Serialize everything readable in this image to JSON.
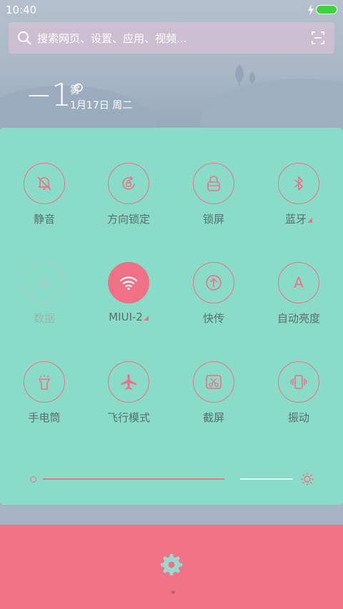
{
  "status_bar": {
    "time": "10:40"
  },
  "search": {
    "placeholder": "搜索网页、设置、应用、视频..."
  },
  "weather": {
    "temperature": "−1°",
    "condition": "雾",
    "date": "1月17日 周二"
  },
  "tiles": [
    {
      "label": "静音",
      "icon": "bell-off-icon",
      "state": "off"
    },
    {
      "label": "方向锁定",
      "icon": "rotation-lock-icon",
      "state": "off"
    },
    {
      "label": "锁屏",
      "icon": "lock-icon",
      "state": "off"
    },
    {
      "label": "蓝牙",
      "icon": "bluetooth-icon",
      "state": "off",
      "has_menu": true
    },
    {
      "label": "数据",
      "icon": "mobile-data-icon",
      "state": "disabled"
    },
    {
      "label": "MIUI-2",
      "icon": "wifi-icon",
      "state": "on",
      "has_menu": true
    },
    {
      "label": "快传",
      "icon": "quick-share-icon",
      "state": "off"
    },
    {
      "label": "自动亮度",
      "icon": "auto-brightness-icon",
      "state": "off",
      "glyph": "A"
    },
    {
      "label": "手电筒",
      "icon": "flashlight-icon",
      "state": "off"
    },
    {
      "label": "飞行模式",
      "icon": "airplane-icon",
      "state": "off"
    },
    {
      "label": "截屏",
      "icon": "screenshot-icon",
      "state": "off"
    },
    {
      "label": "振动",
      "icon": "vibrate-icon",
      "state": "off"
    }
  ],
  "brightness": {
    "level": 0.76
  },
  "colors": {
    "accent": "#f07186",
    "panel": "#89dcc7",
    "footer": "#f17486",
    "battery": "#3fd13f"
  }
}
